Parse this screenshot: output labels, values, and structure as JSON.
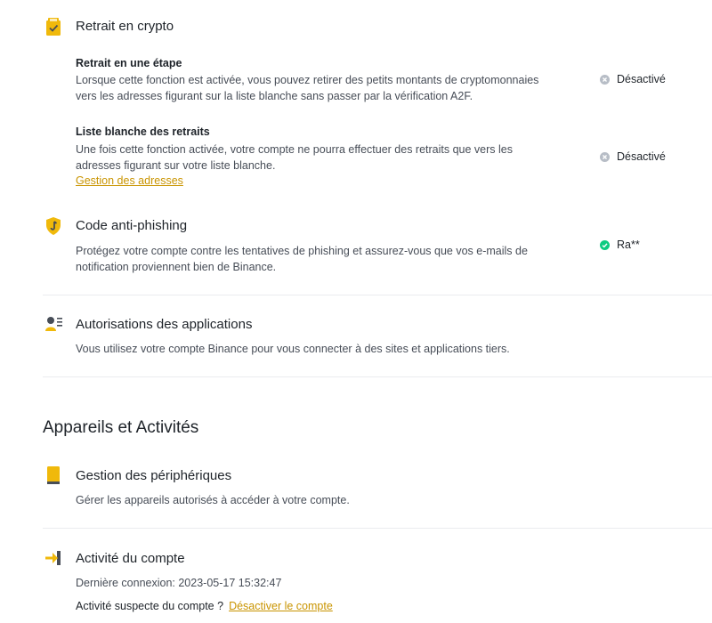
{
  "crypto_withdrawal": {
    "title": "Retrait en crypto",
    "one_step": {
      "title": "Retrait en une étape",
      "desc_line1": "Lorsque cette fonction est activée, vous pouvez retirer des petits montants de cryptomonnaies",
      "desc_line2": "vers les adresses figurant sur la liste blanche sans passer par la vérification A2F.",
      "status": "Désactivé"
    },
    "whitelist": {
      "title": "Liste blanche des retraits",
      "desc_line1": "Une fois cette fonction activée, votre compte ne pourra effectuer des retraits que vers les",
      "desc_line2": "adresses figurant sur votre liste blanche.",
      "link": "Gestion des adresses",
      "status": "Désactivé"
    }
  },
  "anti_phishing": {
    "title": "Code anti-phishing",
    "desc_line1": "Protégez votre compte contre les tentatives de phishing et assurez-vous que vos e-mails de",
    "desc_line2": "notification proviennent bien de Binance.",
    "status": "Ra**"
  },
  "app_auth": {
    "title": "Autorisations des applications",
    "desc": "Vous utilisez votre compte Binance pour vous connecter à des sites et applications tiers."
  },
  "devices_activities": {
    "heading": "Appareils et Activités",
    "device_mgmt": {
      "title": "Gestion des périphériques",
      "desc": "Gérer les appareils autorisés à accéder à votre compte."
    },
    "account_activity": {
      "title": "Activité du compte",
      "last_login": "Dernière connexion: 2023-05-17 15:32:47",
      "suspicious_label": "Activité suspecte du compte ?",
      "deactivate_link": "Désactiver le compte"
    }
  },
  "colors": {
    "accent": "#f0b90b",
    "link": "#c99400",
    "disabled": "#b7bdc6",
    "enabled": "#0ecb81"
  }
}
